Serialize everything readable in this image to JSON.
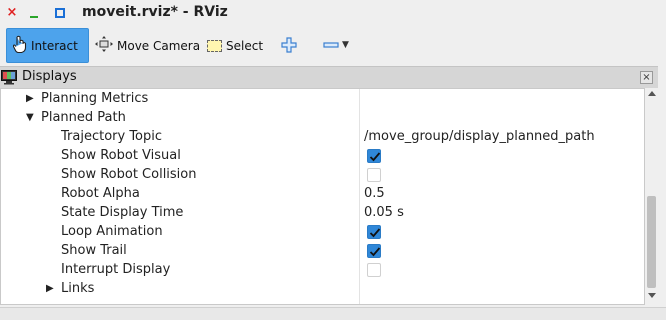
{
  "window": {
    "title": "moveit.rviz* - RViz",
    "controls": {
      "close": "×"
    }
  },
  "toolbar": {
    "interact_label": "Interact",
    "move_camera_label": "Move Camera",
    "select_label": "Select",
    "active_color": "#4da3ec",
    "icons": [
      "hand-pointer-icon",
      "move-camera-icon",
      "select-icon",
      "plus-icon",
      "minus-icon",
      "dropdown-arrow-icon"
    ]
  },
  "displays_panel": {
    "title": "Displays",
    "close_glyph": "×",
    "tree": [
      {
        "label": "Planning Metrics",
        "expander": "▶",
        "level": 1
      },
      {
        "label": "Planned Path",
        "expander": "▼",
        "level": 1
      },
      {
        "label": "Trajectory Topic",
        "value": "/move_group/display_planned_path",
        "level": 2
      },
      {
        "label": "Show Robot Visual",
        "checked": true,
        "level": 2
      },
      {
        "label": "Show Robot Collision",
        "checked": false,
        "level": 2
      },
      {
        "label": "Robot Alpha",
        "value": "0.5",
        "level": 2
      },
      {
        "label": "State Display Time",
        "value": "0.05 s",
        "level": 2
      },
      {
        "label": "Loop Animation",
        "checked": true,
        "level": 2
      },
      {
        "label": "Show Trail",
        "checked": true,
        "level": 2
      },
      {
        "label": "Interrupt Display",
        "checked": false,
        "level": 2
      },
      {
        "label": "Links",
        "expander": "▶",
        "level": 2
      }
    ],
    "checkbox_checked_color": "#2f87d8"
  }
}
